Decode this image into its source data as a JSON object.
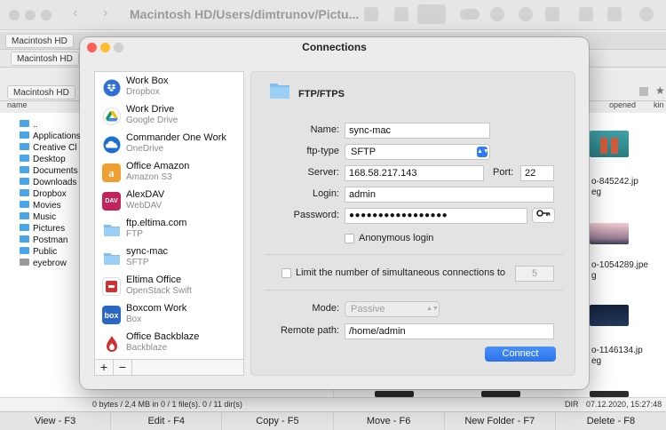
{
  "app": {
    "title": "Macintosh HD/Users/dimtrunov/Pictu...",
    "tabs": [
      "Macintosh HD",
      "Macintosh HD",
      "Macintosh HD"
    ],
    "left_pane": {
      "column_name": "name",
      "folders": [
        "..",
        "Applications",
        "Creative Cl",
        "Desktop",
        "Documents",
        "Downloads",
        "Dropbox",
        "Movies",
        "Music",
        "Pictures",
        "Postman",
        "Public",
        "eyebrow"
      ]
    },
    "right_pane": {
      "columns": [
        "opened",
        "kin"
      ],
      "files": [
        "o-845242.jp\neg",
        "o-1054289.jpe\ng",
        "o-1146134.jp\neg"
      ]
    },
    "status_left": "0 bytes / 2,4 MB in 0 / 1 file(s). 0 / 11 dir(s)",
    "status_right_dir": "DIR",
    "status_right_date": "07.12.2020, 15:27:48",
    "function_keys": [
      "View - F3",
      "Edit - F4",
      "Copy - F5",
      "Move - F6",
      "New Folder - F7",
      "Delete - F8"
    ]
  },
  "dialog": {
    "title": "Connections",
    "connections": [
      {
        "name": "Work Box",
        "sub": "Dropbox",
        "icon": "dropbox-icon",
        "color": "#2e6fd8"
      },
      {
        "name": "Work Drive",
        "sub": "Google Drive",
        "icon": "google-drive-icon",
        "color": "#ffffff"
      },
      {
        "name": "Commander One Work",
        "sub": "OneDrive",
        "icon": "onedrive-icon",
        "color": "#1b6fd0"
      },
      {
        "name": "Office Amazon",
        "sub": "Amazon S3",
        "icon": "amazon-icon",
        "color": "#f0a030"
      },
      {
        "name": "AlexDAV",
        "sub": "WebDAV",
        "icon": "webdav-icon",
        "color": "#c0245c"
      },
      {
        "name": "ftp.eltima.com",
        "sub": "FTP",
        "icon": "ftp-folder-icon",
        "color": "#7dbdf0"
      },
      {
        "name": "sync-mac",
        "sub": "SFTP",
        "icon": "sftp-folder-icon",
        "color": "#7dbdf0"
      },
      {
        "name": "Eltima Office",
        "sub": "OpenStack Swift",
        "icon": "openstack-icon",
        "color": "#d23030"
      },
      {
        "name": "Boxcom Work",
        "sub": "Box",
        "icon": "box-icon",
        "color": "#2a66c6"
      },
      {
        "name": "Office Backblaze",
        "sub": "Backblaze",
        "icon": "backblaze-icon",
        "color": "#d23030"
      }
    ],
    "add_label": "+",
    "remove_label": "−",
    "form": {
      "protocol": "FTP/FTPS",
      "name_label": "Name:",
      "name_value": "sync-mac",
      "type_label": "ftp-type",
      "type_value": "SFTP",
      "server_label": "Server:",
      "server_value": "168.58.217.143",
      "port_label": "Port:",
      "port_value": "22",
      "login_label": "Login:",
      "login_value": "admin",
      "password_label": "Password:",
      "password_value": "●●●●●●●●●●●●●●●●●",
      "anonymous_label": "Anonymous login",
      "limit_label": "Limit the number of simultaneous connections to",
      "limit_value": "5",
      "mode_label": "Mode:",
      "mode_value": "Passive",
      "remote_label": "Remote path:",
      "remote_value": "/home/admin",
      "connect_label": "Connect"
    }
  }
}
